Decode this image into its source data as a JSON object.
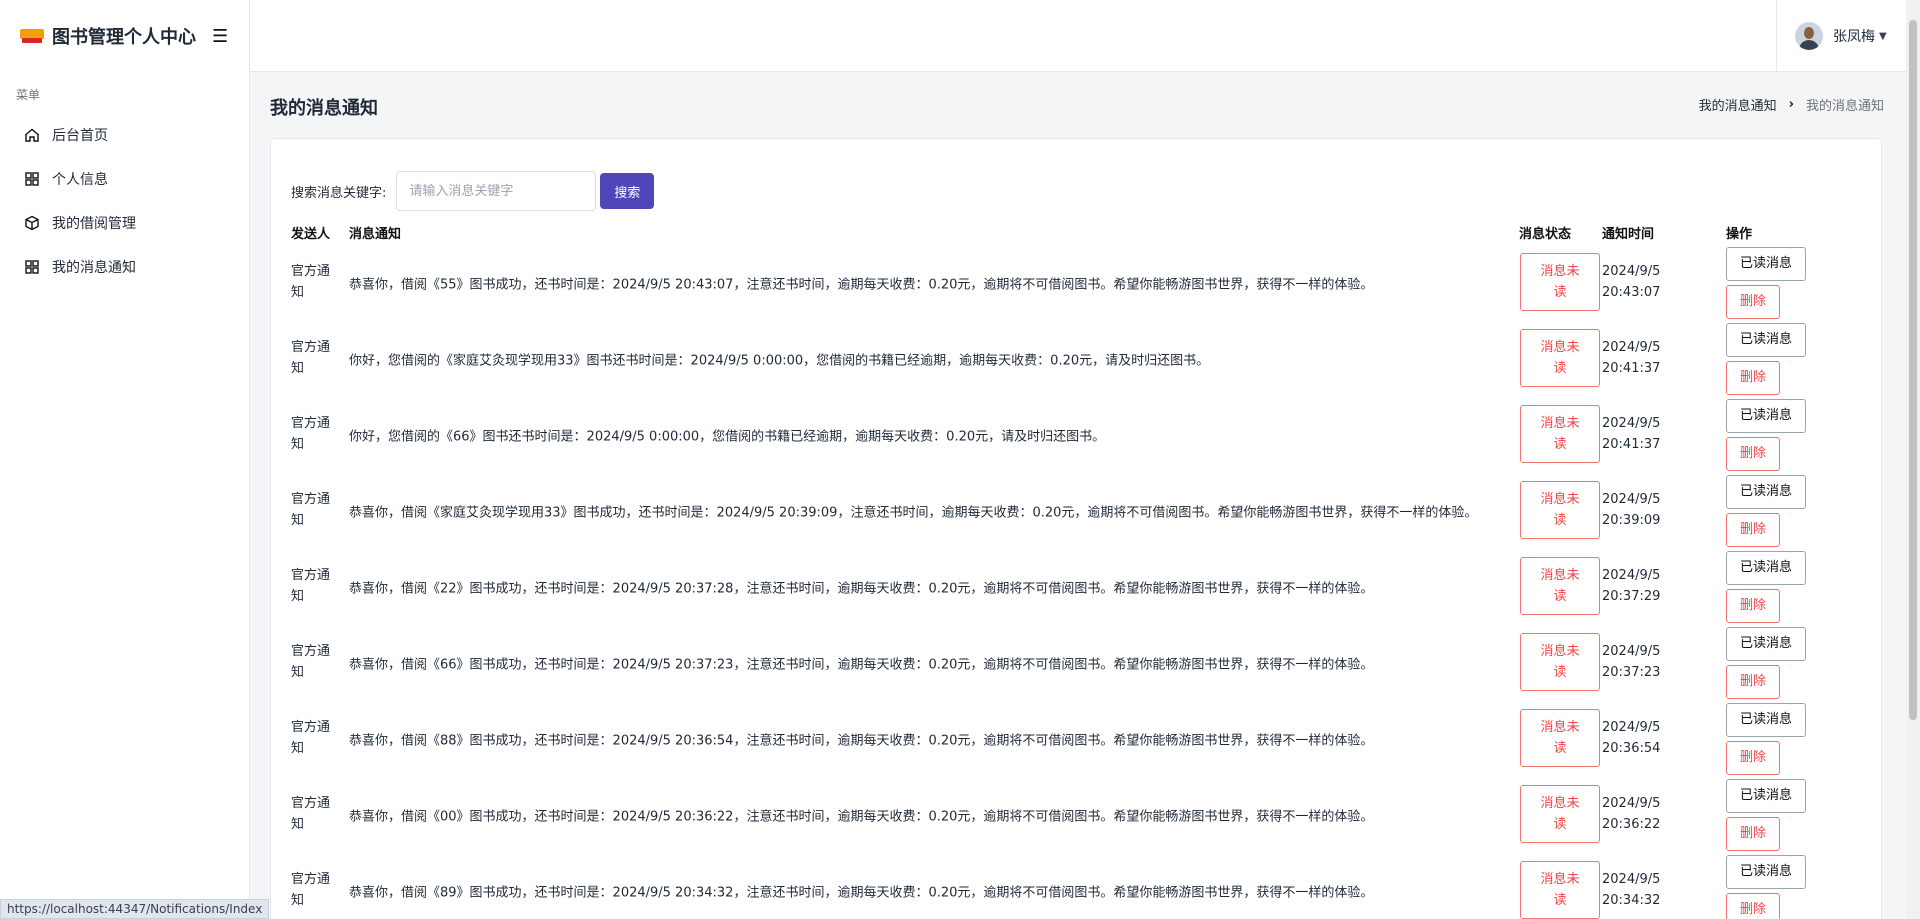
{
  "brand": {
    "title": "图书管理个人中心"
  },
  "sidebar": {
    "heading": "菜单",
    "items": [
      {
        "label": "后台首页",
        "icon": "home-icon"
      },
      {
        "label": "个人信息",
        "icon": "grid-icon"
      },
      {
        "label": "我的借阅管理",
        "icon": "box-icon"
      },
      {
        "label": "我的消息通知",
        "icon": "grid-icon"
      }
    ]
  },
  "header": {
    "user_name": "张凤梅"
  },
  "page": {
    "title": "我的消息通知",
    "breadcrumb": [
      "我的消息通知",
      "我的消息通知"
    ]
  },
  "search": {
    "label": "搜索消息关键字:",
    "placeholder": "请输入消息关键字",
    "value": "",
    "button_label": "搜索"
  },
  "table": {
    "headers": {
      "sender": "发送人",
      "message": "消息通知",
      "status": "消息状态",
      "time": "通知时间",
      "ops": "操作"
    },
    "read_label": "已读消息",
    "delete_label": "删除",
    "rows": [
      {
        "sender": "官方通知",
        "message": "恭喜你，借阅《55》图书成功，还书时间是：2024/9/5 20:43:07，注意还书时间，逾期每天收费：0.20元，逾期将不可借阅图书。希望你能畅游图书世界，获得不一样的体验。",
        "status": "消息未读",
        "date": "2024/9/5",
        "clock": "20:43:07"
      },
      {
        "sender": "官方通知",
        "message": "你好，您借阅的《家庭艾灸现学现用33》图书还书时间是：2024/9/5 0:00:00，您借阅的书籍已经逾期，逾期每天收费：0.20元，请及时归还图书。",
        "status": "消息未读",
        "date": "2024/9/5",
        "clock": "20:41:37"
      },
      {
        "sender": "官方通知",
        "message": "你好，您借阅的《66》图书还书时间是：2024/9/5 0:00:00，您借阅的书籍已经逾期，逾期每天收费：0.20元，请及时归还图书。",
        "status": "消息未读",
        "date": "2024/9/5",
        "clock": "20:41:37"
      },
      {
        "sender": "官方通知",
        "message": "恭喜你，借阅《家庭艾灸现学现用33》图书成功，还书时间是：2024/9/5 20:39:09，注意还书时间，逾期每天收费：0.20元，逾期将不可借阅图书。希望你能畅游图书世界，获得不一样的体验。",
        "status": "消息未读",
        "date": "2024/9/5",
        "clock": "20:39:09"
      },
      {
        "sender": "官方通知",
        "message": "恭喜你，借阅《22》图书成功，还书时间是：2024/9/5 20:37:28，注意还书时间，逾期每天收费：0.20元，逾期将不可借阅图书。希望你能畅游图书世界，获得不一样的体验。",
        "status": "消息未读",
        "date": "2024/9/5",
        "clock": "20:37:29"
      },
      {
        "sender": "官方通知",
        "message": "恭喜你，借阅《66》图书成功，还书时间是：2024/9/5 20:37:23，注意还书时间，逾期每天收费：0.20元，逾期将不可借阅图书。希望你能畅游图书世界，获得不一样的体验。",
        "status": "消息未读",
        "date": "2024/9/5",
        "clock": "20:37:23"
      },
      {
        "sender": "官方通知",
        "message": "恭喜你，借阅《88》图书成功，还书时间是：2024/9/5 20:36:54，注意还书时间，逾期每天收费：0.20元，逾期将不可借阅图书。希望你能畅游图书世界，获得不一样的体验。",
        "status": "消息未读",
        "date": "2024/9/5",
        "clock": "20:36:54"
      },
      {
        "sender": "官方通知",
        "message": "恭喜你，借阅《00》图书成功，还书时间是：2024/9/5 20:36:22，注意还书时间，逾期每天收费：0.20元，逾期将不可借阅图书。希望你能畅游图书世界，获得不一样的体验。",
        "status": "消息未读",
        "date": "2024/9/5",
        "clock": "20:36:22"
      },
      {
        "sender": "官方通知",
        "message": "恭喜你，借阅《89》图书成功，还书时间是：2024/9/5 20:34:32，注意还书时间，逾期每天收费：0.20元，逾期将不可借阅图书。希望你能畅游图书世界，获得不一样的体验。",
        "status": "消息未读",
        "date": "2024/9/5",
        "clock": "20:34:32"
      }
    ]
  },
  "statusbar": {
    "url": "https://localhost:44347/Notifications/Index"
  },
  "colors": {
    "primary": "#4f46b8",
    "danger": "#ef4444"
  }
}
